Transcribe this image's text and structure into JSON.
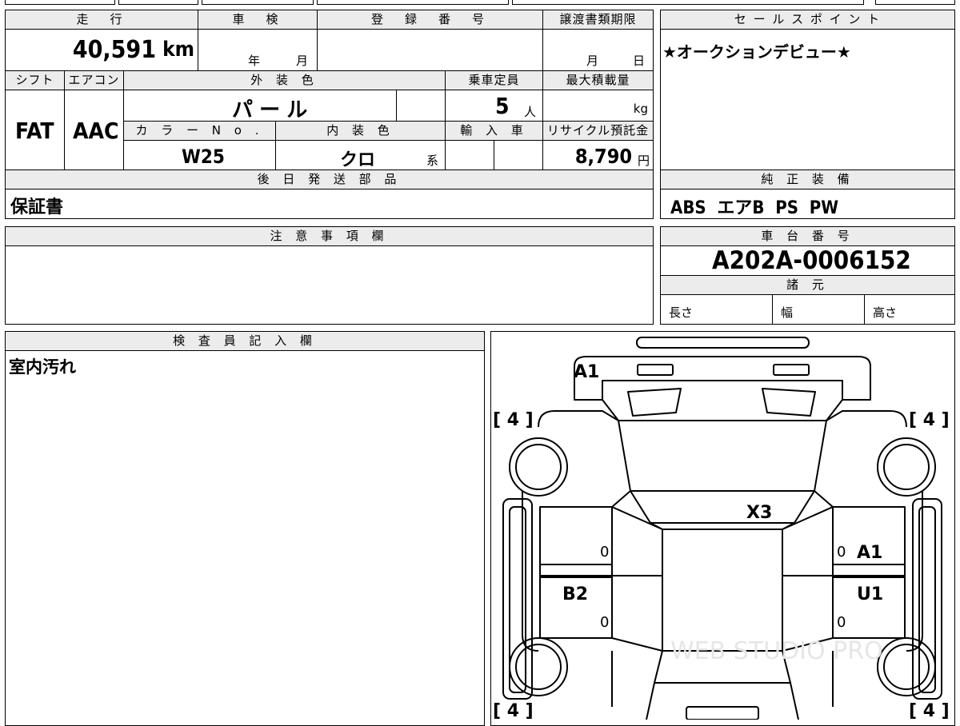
{
  "labels": {
    "mileage": "走　行",
    "inspection": "車　検",
    "registration": "登　録　番　号",
    "transfer_deadline": "譲渡書類期限",
    "sales_point": "セ ー ル ス ポ イ ン ト",
    "shift": "シフト",
    "aircon": "エアコン",
    "exterior_color": "外 装 色",
    "capacity": "乗車定員",
    "max_load": "最大積載量",
    "color_no": "カ ラ ー  N o .",
    "interior_color": "内 装 色",
    "import": "輸 入 車",
    "recycle": "リサイクル預託金",
    "later_parts": "後 日 発 送 部 品",
    "genuine_equipment": "純 正 装 備",
    "notes": "注 意 事 項 欄",
    "chassis_no": "車 台 番 号",
    "specs": "諸 元",
    "length": "長さ",
    "width": "幅",
    "height": "高さ",
    "inspector": "検 査 員 記 入 欄"
  },
  "values": {
    "mileage": "40,591",
    "mileage_unit": "km",
    "inspection_year": "年",
    "inspection_month": "月",
    "transfer_month": "月",
    "transfer_day": "日",
    "shift": "FAT",
    "aircon": "AAC",
    "exterior_color": "パ ー ル",
    "capacity": "5",
    "capacity_unit": "人",
    "max_load_unit": "kg",
    "color_no": "W25",
    "interior_color": "クロ",
    "interior_suffix": "系",
    "recycle_fee": "8,790",
    "recycle_unit": "円",
    "later_parts": "保証書",
    "genuine_equipment": "ABS  エアB  PS  PW",
    "chassis_no": "A202A-0006152",
    "sales_point": "★オークションデビュー★",
    "inspector_notes": "室内汚れ"
  },
  "diagram": {
    "marks": {
      "front_bumper": "A1",
      "roof_glass": "X3",
      "right_door": "A1",
      "left_rear_door": "B2",
      "right_rear_door": "U1"
    },
    "tire_fl": "[ 4 ]",
    "tire_fr": "[ 4 ]",
    "tire_rl": "[ 4 ]",
    "tire_rr": "[ 4 ]",
    "zero": "0",
    "watermark": "WEB STUDIO PRO"
  }
}
